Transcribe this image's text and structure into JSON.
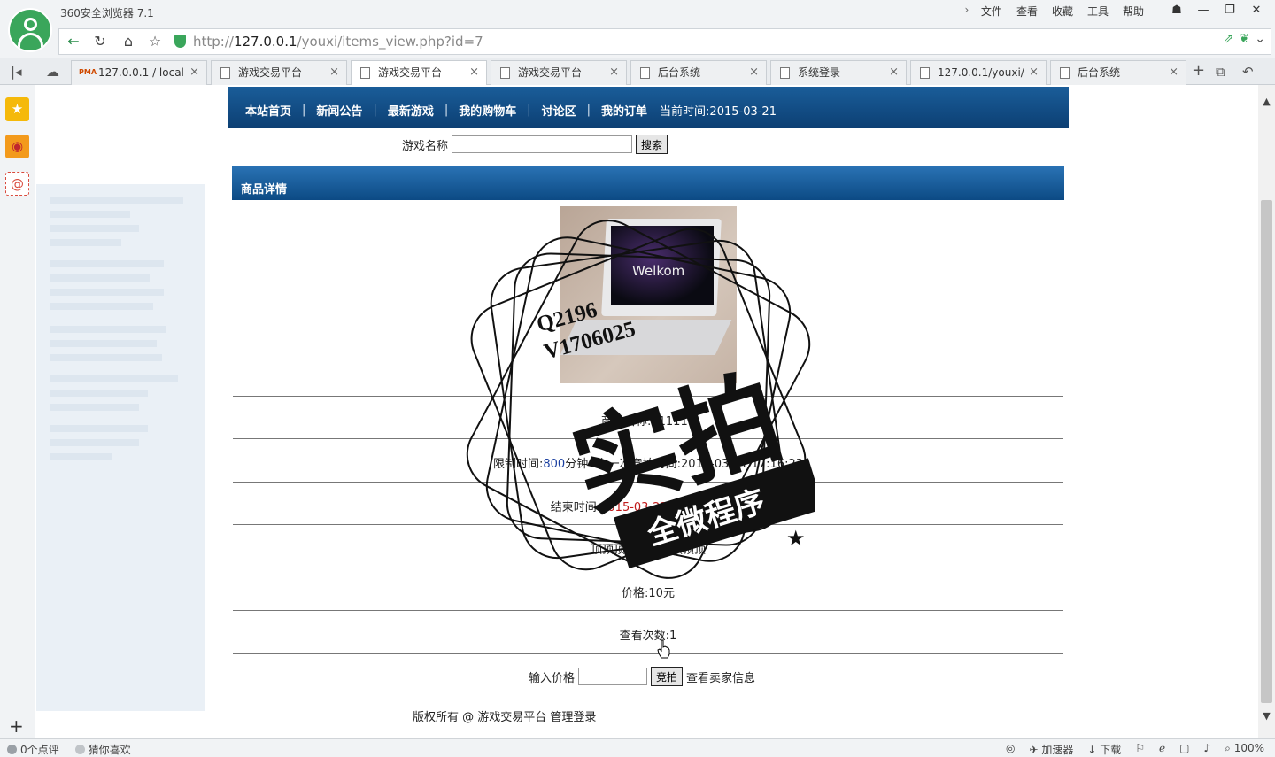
{
  "browser": {
    "app_title": "360安全浏览器 7.1",
    "menu": [
      "文件",
      "查看",
      "收藏",
      "工具",
      "帮助"
    ],
    "url": {
      "scheme": "http://",
      "host": "127.0.0.1",
      "path": "/youxi/items_view.php?id=7"
    },
    "tabs": [
      {
        "label": "127.0.0.1 / local",
        "icon": "pma-icon"
      },
      {
        "label": "游戏交易平台",
        "icon": "page-icon"
      },
      {
        "label": "游戏交易平台",
        "icon": "page-icon",
        "active": true
      },
      {
        "label": "游戏交易平台",
        "icon": "page-icon"
      },
      {
        "label": "后台系统",
        "icon": "page-icon"
      },
      {
        "label": "系统登录",
        "icon": "page-icon"
      },
      {
        "label": "127.0.0.1/youxi/",
        "icon": "page-icon"
      },
      {
        "label": "后台系统",
        "icon": "page-icon"
      }
    ],
    "status": {
      "comments": "0个点评",
      "guess": "猜你喜欢",
      "accelerator": "加速器",
      "download": "下载",
      "zoom": "100%"
    }
  },
  "site": {
    "nav": {
      "home": "本站首页",
      "news": "新闻公告",
      "games": "最新游戏",
      "cart": "我的购物车",
      "forum": "讨论区",
      "orders": "我的订单",
      "current_time": "当前时间:2015-03-21"
    },
    "search": {
      "label": "游戏名称",
      "value": "",
      "button": "搜索"
    },
    "detail": {
      "header": "商品详情",
      "name_row": "商品名称:111111",
      "limit_label": "限制时间:",
      "limit_value": "800",
      "limit_suffix": "分钟--上一次竞拍时间:2015-03-21 17:16:23",
      "end_label": "结束时间:",
      "end_value": "2015-03-22 06:36:23",
      "end_suffix": "分钟",
      "desc_row": "顶顶顶顶顶顶顶顶顶顶",
      "price_row": "价格:10元",
      "views_row": "查看次数:1",
      "photo_text": "Welkom"
    },
    "bid": {
      "label": "输入价格",
      "value": "",
      "button": "竞拍",
      "seller_link": "查看卖家信息"
    },
    "footer": {
      "copyright": "版权所有 @ 游戏交易平台",
      "admin": "管理登录"
    }
  },
  "watermark": {
    "line1": "Q2196",
    "line2": "V1706025",
    "big": "实拍",
    "ribbon": "全微程序"
  }
}
